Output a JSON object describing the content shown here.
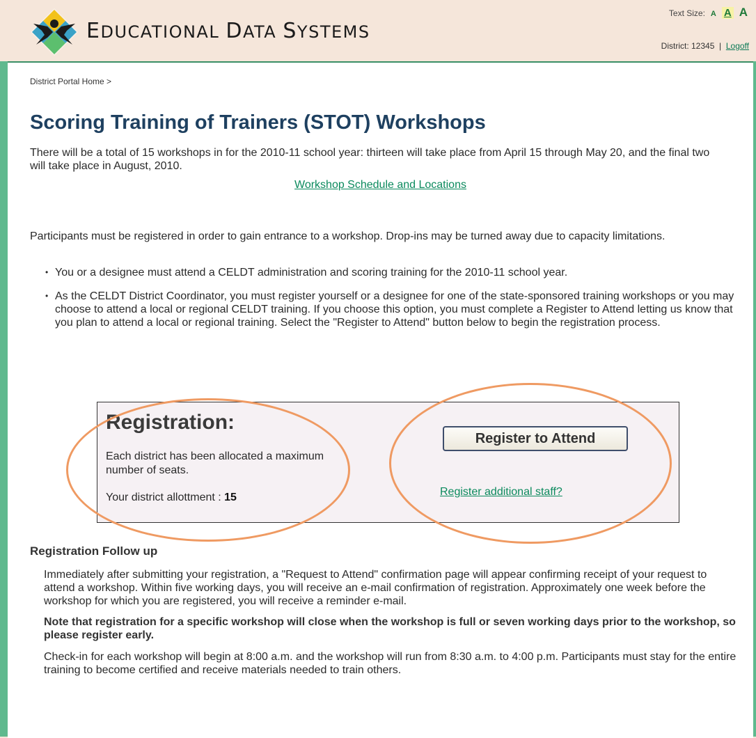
{
  "header": {
    "brand": {
      "e": "E",
      "ducational": "DUCATIONAL",
      "d": "D",
      "ata": "ATA",
      "s": "S",
      "ystems": "YSTEMS"
    },
    "text_size_label": "Text Size:",
    "text_size_options": [
      "A",
      "A",
      "A"
    ],
    "district_label": "District: 12345",
    "separator": "|",
    "logoff": "Logoff"
  },
  "breadcrumb": {
    "home": "District Portal Home",
    "sep": ">"
  },
  "page_title": "Scoring Training of Trainers (STOT) Workshops",
  "intro": "There will be a total of 15 workshops in for the 2010-11 school year: thirteen will take place from April 15 through May 20, and the final two will take place in August, 2010.",
  "schedule_link": "Workshop Schedule and Locations",
  "participants": "Participants must be registered in order to gain entrance to a workshop. Drop-ins may be turned away due to capacity limitations.",
  "bullets": [
    "You or a designee must attend a CELDT administration and scoring training for the 2010-11 school year.",
    "As the CELDT District Coordinator, you must register yourself or a designee for one of the state-sponsored training workshops or you may choose to attend a local or regional CELDT training. If you choose this option, you must complete a Register to Attend letting us know that you plan to attend a local or regional training. Select the \"Register to Attend\" button below to begin the registration process."
  ],
  "registration": {
    "title": "Registration:",
    "text": "Each district has been allocated a maximum number of seats.",
    "allotment_label": "Your district allottment :",
    "allotment_value": "15",
    "button": "Register to Attend",
    "additional_link": "Register additional staff?"
  },
  "followup": {
    "heading": "Registration Follow up",
    "p1": "Immediately after submitting your registration, a \"Request to Attend\" confirmation page will appear confirming receipt of your request to attend a workshop. Within five working days, you will receive an e-mail confirmation of registration. Approximately one week before the workshop for which you are registered, you will receive a reminder e-mail.",
    "note": "Note that registration for a specific workshop will close when the workshop is full or seven working days prior to the workshop, so please register early.",
    "p3": "Check-in for each workshop will begin at 8:00 a.m. and the workshop will run from 8:30 a.m. to 4:00 p.m. Participants must stay for the entire training to become certified and receive materials needed to train others."
  },
  "colors": {
    "accent_green": "#5fb98e",
    "link": "#0b8a5d",
    "title": "#1e4060",
    "highlight": "#ef9a62"
  },
  "icons": {
    "logo": "person-star-logo-icon"
  }
}
